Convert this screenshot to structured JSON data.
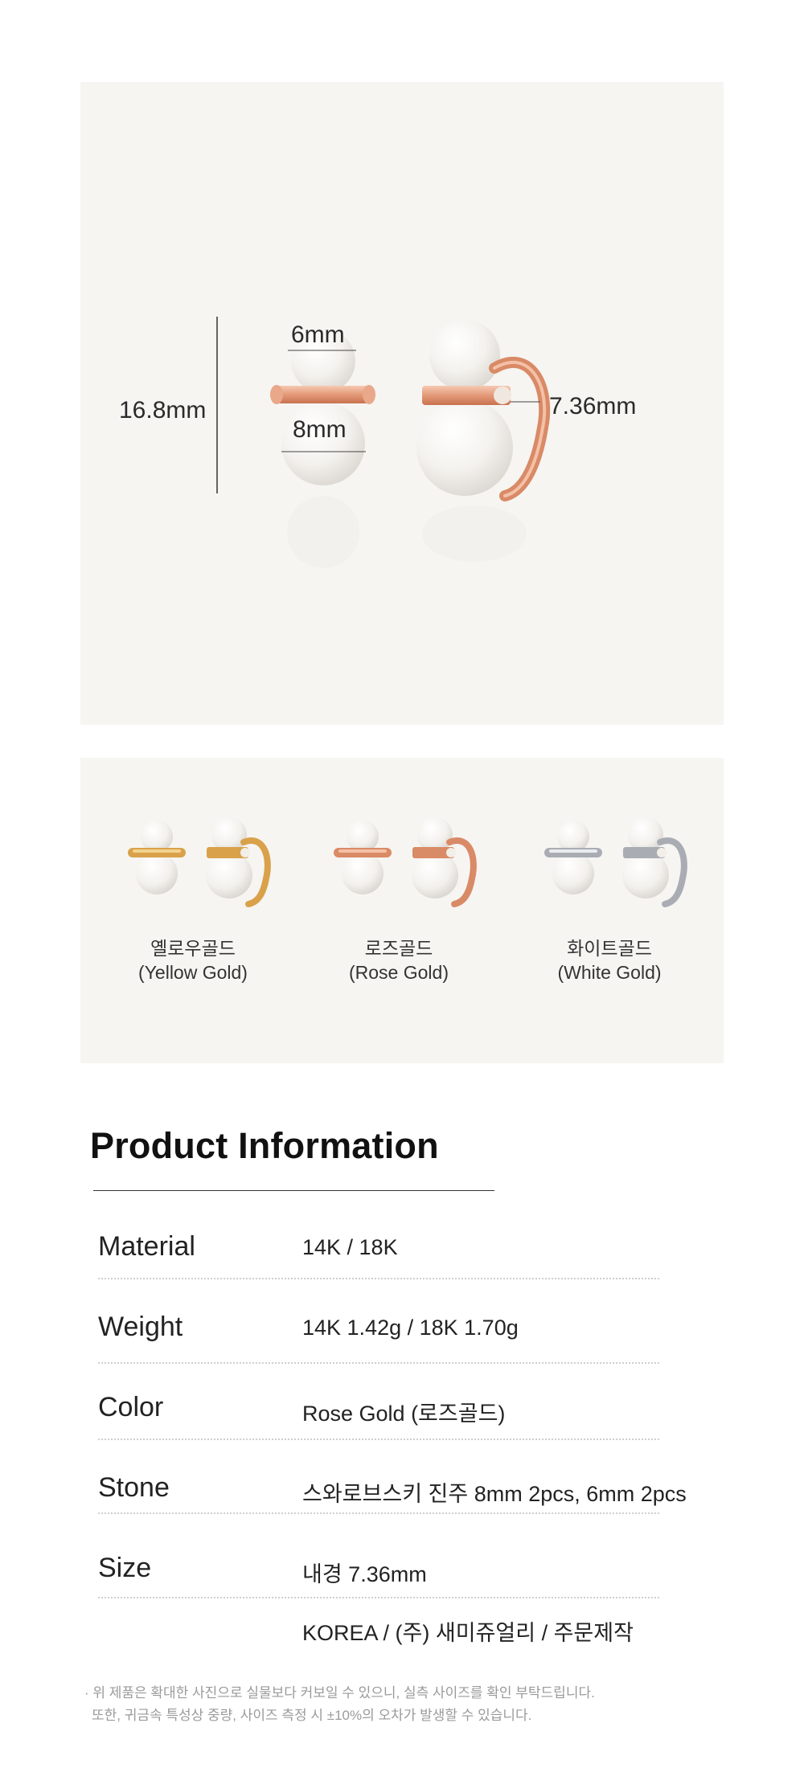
{
  "hero": {
    "total_height": "16.8mm",
    "top_pearl": "6mm",
    "bottom_pearl": "8mm",
    "inner_diameter": "7.36mm"
  },
  "colors": [
    {
      "name": "옐로우골드",
      "sub": "(Yellow Gold)",
      "metal": "#d9a24a",
      "metal_light": "#f3d38e"
    },
    {
      "name": "로즈골드",
      "sub": "(Rose Gold)",
      "metal": "#d98a66",
      "metal_light": "#f4c1a6"
    },
    {
      "name": "화이트골드",
      "sub": "(White Gold)",
      "metal": "#a9adb3",
      "metal_light": "#e9ebee"
    }
  ],
  "product_info": {
    "title": "Product Information",
    "rows": [
      {
        "label": "Material",
        "value": "14K / 18K"
      },
      {
        "label": "Weight",
        "value": "14K 1.42g / 18K 1.70g"
      },
      {
        "label": "Color",
        "value": "Rose Gold (로즈골드)"
      },
      {
        "label": "Stone",
        "value": "스와로브스키 진주 8mm 2pcs, 6mm 2pcs"
      },
      {
        "label": "Size",
        "value": "내경 7.36mm"
      }
    ],
    "origin": "KOREA / (주) 새미쥬얼리 / 주문제작"
  },
  "notes": [
    "· 위 제품은 확대한 사진으로 실물보다 커보일 수 있으니, 실측 사이즈를 확인 부탁드립니다.",
    "또한, 귀금속 특성상 중량,  사이즈 측정 시 ±10%의 오차가 발생할 수 있습니다."
  ]
}
